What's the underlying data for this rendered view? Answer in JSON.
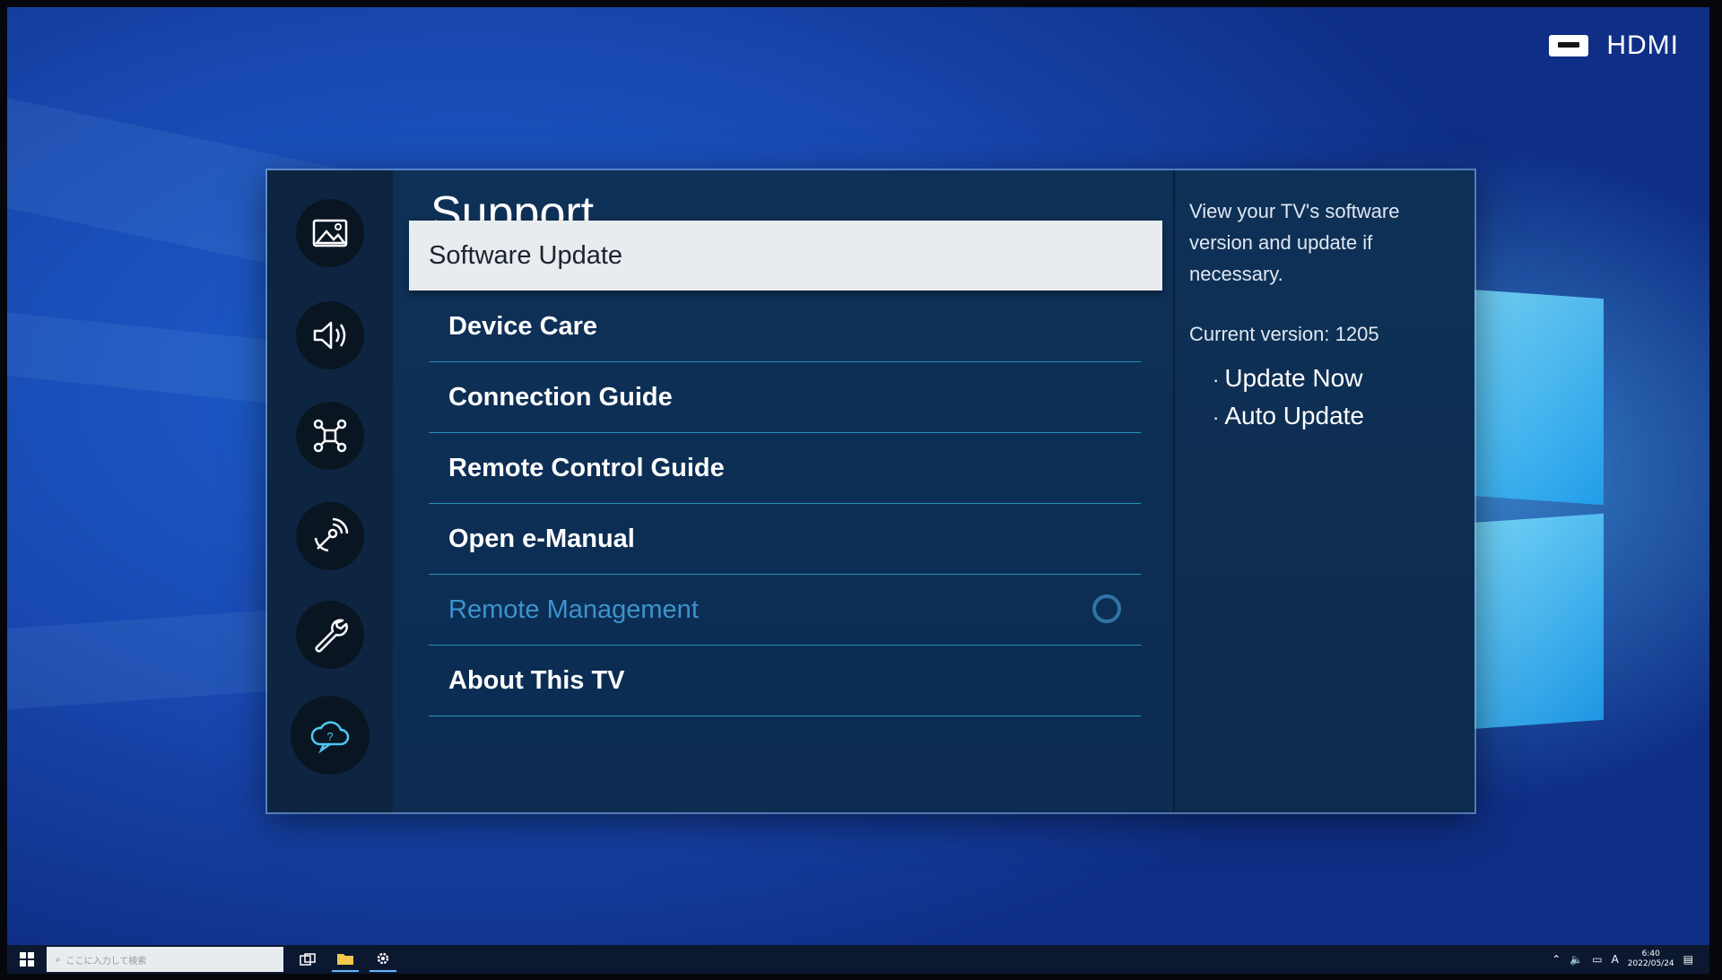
{
  "input_source": {
    "label": "HDMI",
    "icon": "hdmi-port-icon"
  },
  "rail": {
    "items": [
      {
        "name": "picture-icon"
      },
      {
        "name": "sound-icon"
      },
      {
        "name": "connection-icon"
      },
      {
        "name": "broadcasting-icon"
      },
      {
        "name": "general-icon"
      },
      {
        "name": "support-icon",
        "active": true
      }
    ]
  },
  "main": {
    "title": "Support",
    "items": [
      {
        "label": "Software Update",
        "selected": true
      },
      {
        "label": "Device Care"
      },
      {
        "label": "Connection Guide"
      },
      {
        "label": "Remote Control Guide"
      },
      {
        "label": "Open e-Manual"
      },
      {
        "label": "Remote Management",
        "dimmed": true,
        "toggle": "off"
      },
      {
        "label": "About This TV"
      }
    ]
  },
  "info": {
    "description": "View your TV's software version and update if necessary.",
    "current_version": "Current version: 1205",
    "options": [
      "Update Now",
      "Auto Update"
    ]
  },
  "taskbar": {
    "search_placeholder": "ここに入力して検索",
    "time": "6:40",
    "date": "2022/05/24",
    "ime": "A"
  },
  "colors": {
    "accent": "#2f74a4",
    "selected_bg": "#e9ecee",
    "divider": "#2a8fb4",
    "dimmed_text": "#3c93cd"
  }
}
